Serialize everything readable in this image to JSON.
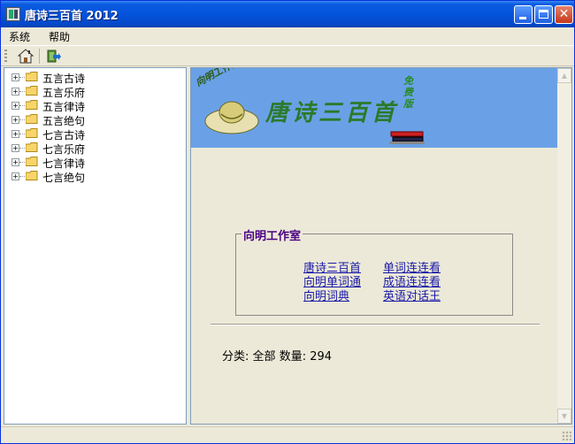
{
  "window": {
    "title": "唐诗三百首 2012"
  },
  "menu": {
    "items": [
      "系统",
      "帮助"
    ]
  },
  "toolbar": {
    "buttons": [
      "home-icon",
      "exit-icon"
    ]
  },
  "tree": {
    "items": [
      {
        "label": "五言古诗",
        "expander": "+"
      },
      {
        "label": "五言乐府",
        "expander": "+"
      },
      {
        "label": "五言律诗",
        "expander": "+"
      },
      {
        "label": "五言绝句",
        "expander": "+"
      },
      {
        "label": "七言古诗",
        "expander": "+"
      },
      {
        "label": "七言乐府",
        "expander": "+"
      },
      {
        "label": "七言律诗",
        "expander": "+"
      },
      {
        "label": "七言绝句",
        "expander": "+"
      }
    ]
  },
  "banner": {
    "title": "唐诗三百首",
    "badge": "免费版",
    "studio": "向明工作室"
  },
  "links_box": {
    "legend": "向明工作室",
    "links": [
      "唐诗三百首",
      "单词连连看",
      "向明单词通",
      "成语连连看",
      "向明词典",
      "英语对话王"
    ]
  },
  "status": {
    "category_label": "分类:",
    "category_value": "全部",
    "count_label": "数量:",
    "count_value": "294"
  },
  "colors": {
    "titlebar": "#0553dc",
    "banner_bg": "#6aa1e6",
    "link": "#1a1aa8",
    "legend": "#4b0082"
  }
}
